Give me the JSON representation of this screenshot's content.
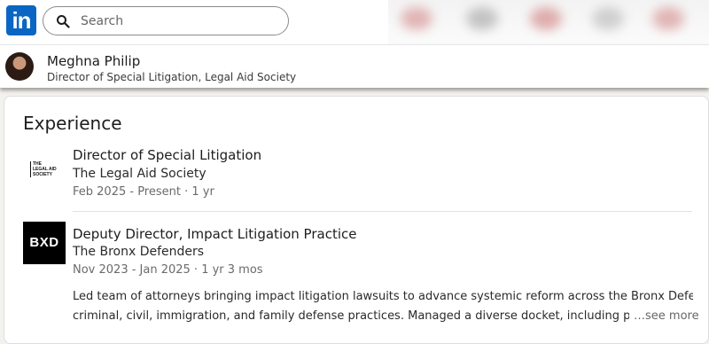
{
  "nav": {
    "logo_text": "in",
    "search_placeholder": "Search",
    "brand_color": "#0a66c2"
  },
  "profile_header": {
    "name": "Meghna Philip",
    "headline": "Director of Special Litigation, Legal Aid Society"
  },
  "experience": {
    "title": "Experience",
    "items": [
      {
        "role": "Director of Special Litigation",
        "organization": "The Legal Aid Society",
        "dates": "Feb 2025 - Present · 1 yr",
        "logo_lines": [
          "THE",
          "LEGAL AID",
          "SOCIETY"
        ]
      },
      {
        "role": "Deputy Director, Impact Litigation Practice",
        "organization": "The Bronx Defenders",
        "dates": "Nov 2023 - Jan 2025 · 1 yr 3 mos",
        "logo_text": "BXD",
        "description_line1": "Led team of attorneys bringing impact litigation lawsuits to advance systemic reform across the Bronx Defenders'",
        "description_line2": "criminal, civil, immigration, and family defense practices. Managed a diverse docket, including post-ve",
        "see_more": "…see more"
      }
    ]
  }
}
